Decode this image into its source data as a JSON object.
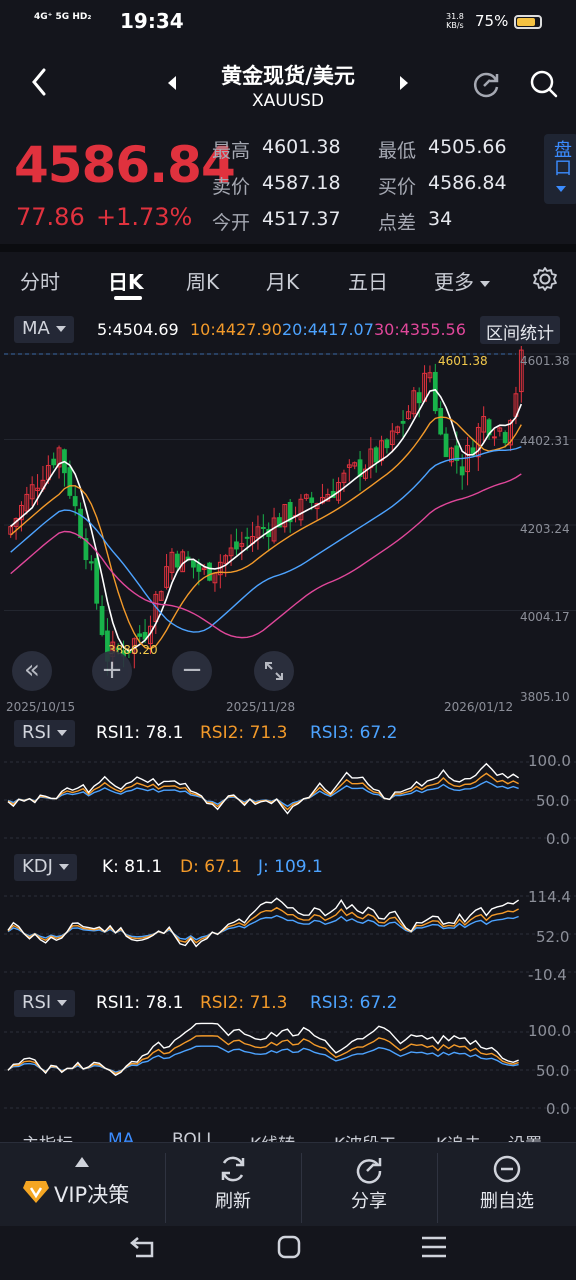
{
  "status": {
    "network": "4G⁺ 5G HD₂",
    "time": "19:34",
    "speed_top": "31.8",
    "speed_bottom": "KB/s",
    "battery": "75%"
  },
  "header": {
    "title": "黄金现货/美元",
    "subtitle": "XAUUSD"
  },
  "quote": {
    "price": "4586.84",
    "change": "77.86",
    "change_pct": "+1.73%",
    "fields": [
      {
        "label": "最高",
        "value": "4601.38"
      },
      {
        "label": "最低",
        "value": "4505.66"
      },
      {
        "label": "卖价",
        "value": "4587.18"
      },
      {
        "label": "买价",
        "value": "4586.84"
      },
      {
        "label": "今开",
        "value": "4517.37"
      },
      {
        "label": "点差",
        "value": "34"
      }
    ],
    "pankou_label": "盘口"
  },
  "tabs": [
    {
      "label": "分时"
    },
    {
      "label": "日K"
    },
    {
      "label": "周K"
    },
    {
      "label": "月K"
    },
    {
      "label": "五日"
    },
    {
      "label": "更多"
    }
  ],
  "ma": {
    "selector": "MA",
    "ma5": "5:4504.69",
    "ma10": "10:4427.90",
    "ma20": "20:4417.07",
    "ma30": "30:4355.56",
    "range_stats": "区间统计",
    "high_marker": "4601.38",
    "low_marker": "3886.20",
    "y_ticks": [
      "4601.38",
      "4402.31",
      "4203.24",
      "4004.17",
      "3805.10"
    ],
    "x_ticks": [
      "2025/10/15",
      "2025/11/28",
      "2026/01/12"
    ]
  },
  "rsi": {
    "selector": "RSI",
    "rsi1": "RSI1: 78.1",
    "rsi2": "RSI2: 71.3",
    "rsi3": "RSI3: 67.2",
    "y_ticks": [
      "100.0",
      "50.0",
      "0.0"
    ]
  },
  "kdj": {
    "selector": "KDJ",
    "k": "K: 81.1",
    "d": "D: 67.1",
    "j": "J: 109.1",
    "y_ticks": [
      "114.4",
      "52.0",
      "-10.4"
    ]
  },
  "rsi_b": {
    "selector": "RSI",
    "rsi1": "RSI1: 78.1",
    "rsi2": "RSI2: 71.3",
    "rsi3": "RSI3: 67.2",
    "y_ticks": [
      "100.0",
      "50.0",
      "0.0"
    ]
  },
  "indicator_menu": [
    "主指标",
    "MA",
    "BOLL",
    "K线转",
    "K波段工",
    "K追击",
    "设置"
  ],
  "bottom": {
    "vip": "VIP决策",
    "refresh": "刷新",
    "share": "分享",
    "remove": "删自选"
  },
  "colors": {
    "up": "#e0323e",
    "down": "#18b24a",
    "ma5": "#ffffff",
    "ma10": "#f39a2a",
    "ma20": "#4da3ff",
    "ma30": "#e0479a",
    "accent": "#3b8cff"
  },
  "chart_data": {
    "type": "candlestick",
    "y_range": [
      3805.1,
      4601.38
    ],
    "x_labels": [
      "2025/10/15",
      "2025/11/28",
      "2026/01/12"
    ],
    "series": [
      {
        "name": "MA5",
        "last": 4504.69
      },
      {
        "name": "MA10",
        "last": 4427.9
      },
      {
        "name": "MA20",
        "last": 4417.07
      },
      {
        "name": "MA30",
        "last": 4355.56
      }
    ],
    "high": 4601.38,
    "low": 3886.2
  }
}
